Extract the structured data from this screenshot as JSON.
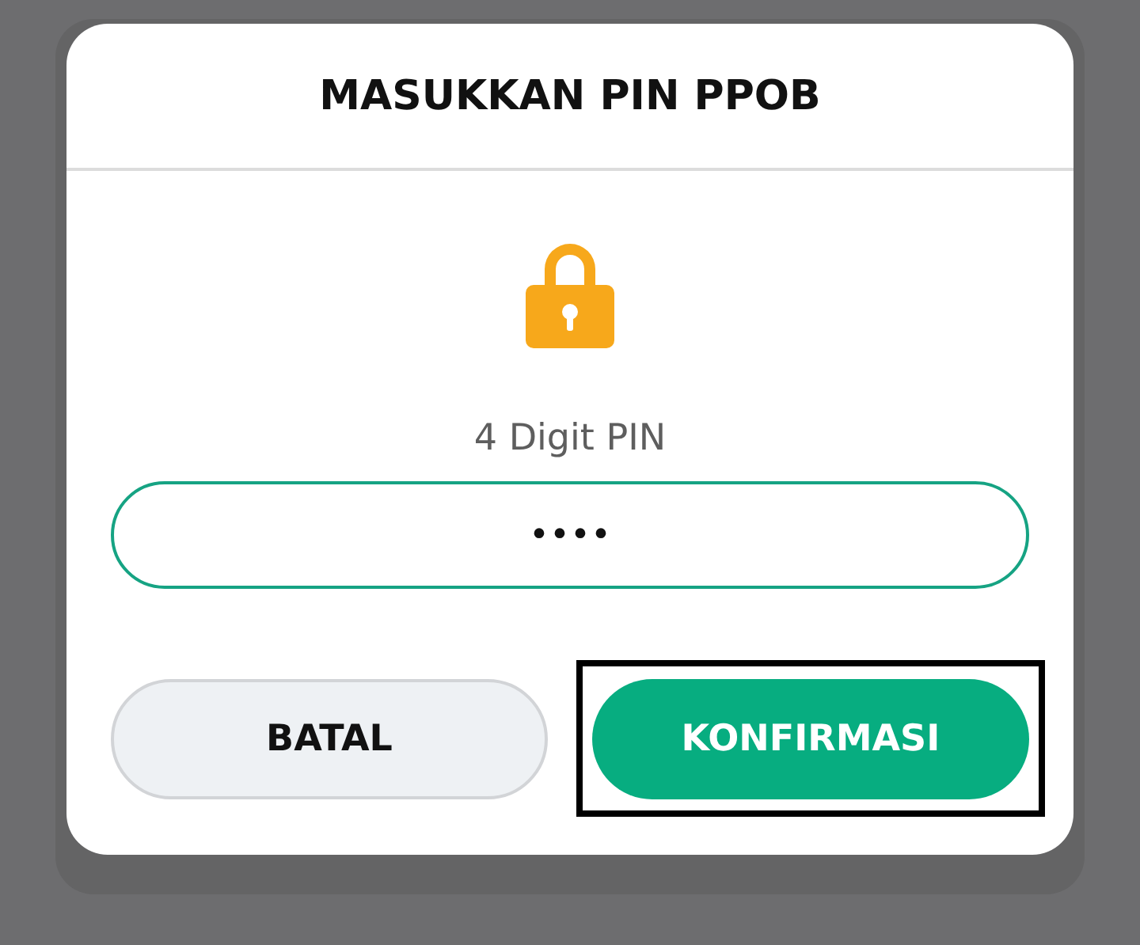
{
  "dialog": {
    "title": "MASUKKAN PIN PPOB",
    "label": "4 Digit PIN",
    "pin_field": {
      "value": "••••"
    },
    "buttons": [
      {
        "label": "BATAL",
        "kind": "secondary",
        "highlighted": false
      },
      {
        "label": "KONFIRMASI",
        "kind": "primary",
        "highlighted": true
      }
    ]
  }
}
